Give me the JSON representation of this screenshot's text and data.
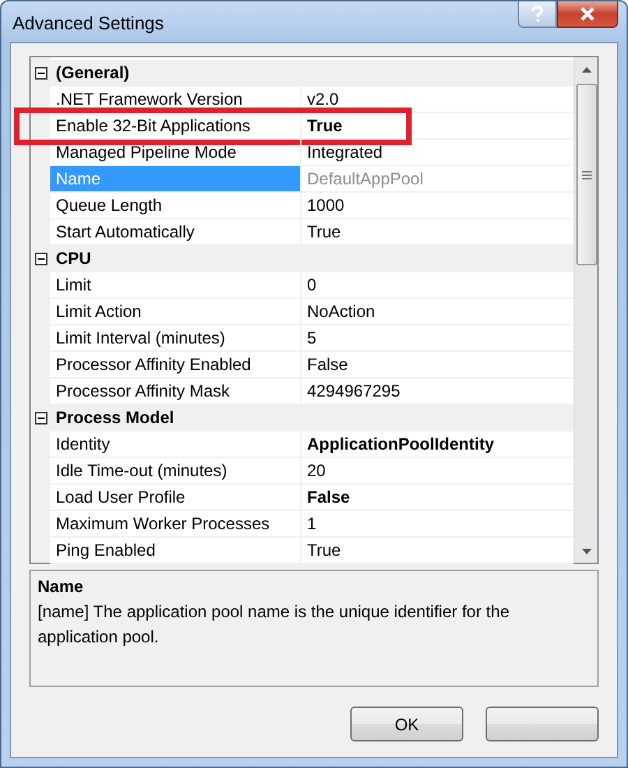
{
  "window": {
    "title": "Advanced Settings"
  },
  "categories": [
    {
      "label": "(General)",
      "expanded": true,
      "properties": [
        {
          "name": ".NET Framework Version",
          "value": "v2.0",
          "bold": false,
          "selected": false,
          "read_only": false,
          "highlighted": false
        },
        {
          "name": "Enable 32-Bit Applications",
          "value": "True",
          "bold": true,
          "selected": false,
          "read_only": false,
          "highlighted": true
        },
        {
          "name": "Managed Pipeline Mode",
          "value": "Integrated",
          "bold": false,
          "selected": false,
          "read_only": false,
          "highlighted": false
        },
        {
          "name": "Name",
          "value": "DefaultAppPool",
          "bold": false,
          "selected": true,
          "read_only": true,
          "highlighted": false
        },
        {
          "name": "Queue Length",
          "value": "1000",
          "bold": false,
          "selected": false,
          "read_only": false,
          "highlighted": false
        },
        {
          "name": "Start Automatically",
          "value": "True",
          "bold": false,
          "selected": false,
          "read_only": false,
          "highlighted": false
        }
      ]
    },
    {
      "label": "CPU",
      "expanded": true,
      "properties": [
        {
          "name": "Limit",
          "value": "0",
          "bold": false,
          "selected": false,
          "read_only": false,
          "highlighted": false
        },
        {
          "name": "Limit Action",
          "value": "NoAction",
          "bold": false,
          "selected": false,
          "read_only": false,
          "highlighted": false
        },
        {
          "name": "Limit Interval (minutes)",
          "value": "5",
          "bold": false,
          "selected": false,
          "read_only": false,
          "highlighted": false
        },
        {
          "name": "Processor Affinity Enabled",
          "value": "False",
          "bold": false,
          "selected": false,
          "read_only": false,
          "highlighted": false
        },
        {
          "name": "Processor Affinity Mask",
          "value": "4294967295",
          "bold": false,
          "selected": false,
          "read_only": false,
          "highlighted": false
        }
      ]
    },
    {
      "label": "Process Model",
      "expanded": true,
      "properties": [
        {
          "name": "Identity",
          "value": "ApplicationPoolIdentity",
          "bold": true,
          "selected": false,
          "read_only": false,
          "highlighted": false
        },
        {
          "name": "Idle Time-out (minutes)",
          "value": "20",
          "bold": false,
          "selected": false,
          "read_only": false,
          "highlighted": false
        },
        {
          "name": "Load User Profile",
          "value": "False",
          "bold": true,
          "selected": false,
          "read_only": false,
          "highlighted": false
        },
        {
          "name": "Maximum Worker Processes",
          "value": "1",
          "bold": false,
          "selected": false,
          "read_only": false,
          "highlighted": false
        },
        {
          "name": "Ping Enabled",
          "value": "True",
          "bold": false,
          "selected": false,
          "read_only": false,
          "highlighted": false
        }
      ]
    }
  ],
  "description": {
    "title": "Name",
    "text": "[name] The application pool name is the unique identifier for the application pool."
  },
  "buttons": [
    {
      "kind": "button",
      "label": "OK"
    },
    {
      "kind": "button"
    }
  ]
}
